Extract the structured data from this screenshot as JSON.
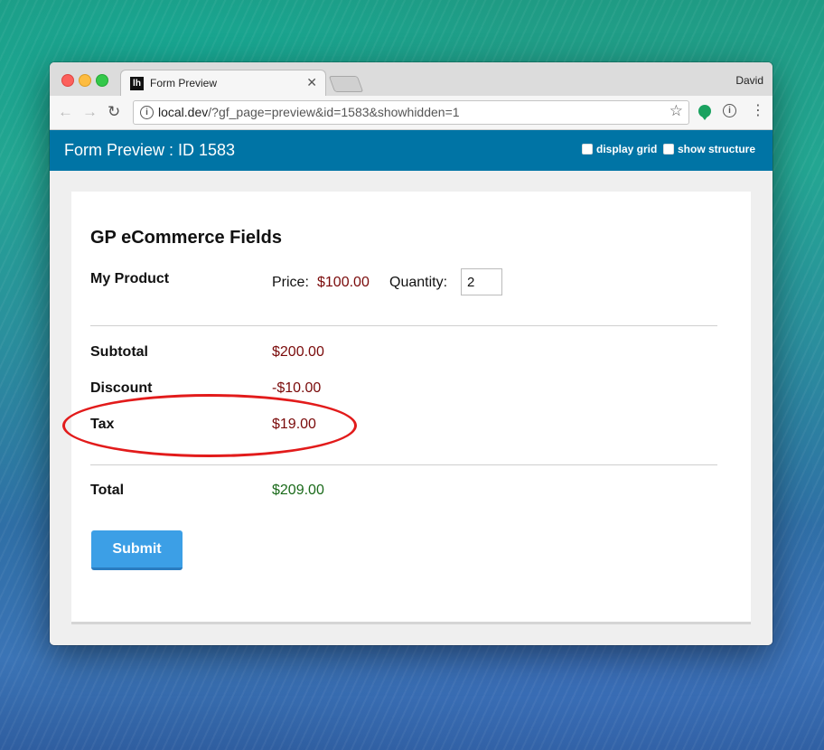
{
  "browser": {
    "tab_title": "Form Preview",
    "tab_favicon": "lh",
    "profile_name": "David",
    "url_host": "local.dev",
    "url_path": "/?gf_page=preview&id=1583&showhidden=1"
  },
  "header": {
    "title": "Form Preview : ID 1583",
    "display_grid_label": "display grid",
    "show_structure_label": "show structure"
  },
  "form": {
    "title": "GP eCommerce Fields",
    "product": {
      "label": "My Product",
      "price_label": "Price:",
      "price_value": "$100.00",
      "quantity_label": "Quantity:",
      "quantity_value": "2"
    },
    "subtotal": {
      "label": "Subtotal",
      "value": "$200.00"
    },
    "discount": {
      "label": "Discount",
      "value": "-$10.00"
    },
    "tax": {
      "label": "Tax",
      "value": "$19.00"
    },
    "total": {
      "label": "Total",
      "value": "$209.00"
    },
    "submit_label": "Submit"
  },
  "colors": {
    "header_bg": "#0074a5",
    "price_color": "#7a0a0a",
    "total_color": "#1a6a1a",
    "submit_bg": "#3c9fe6",
    "annotation": "#e21b1b"
  },
  "icons": {
    "back": "arrow-left-icon",
    "forward": "arrow-right-icon",
    "reload": "reload-icon",
    "info": "info-icon",
    "bookmark": "star-icon",
    "menu": "more-vertical-icon"
  }
}
